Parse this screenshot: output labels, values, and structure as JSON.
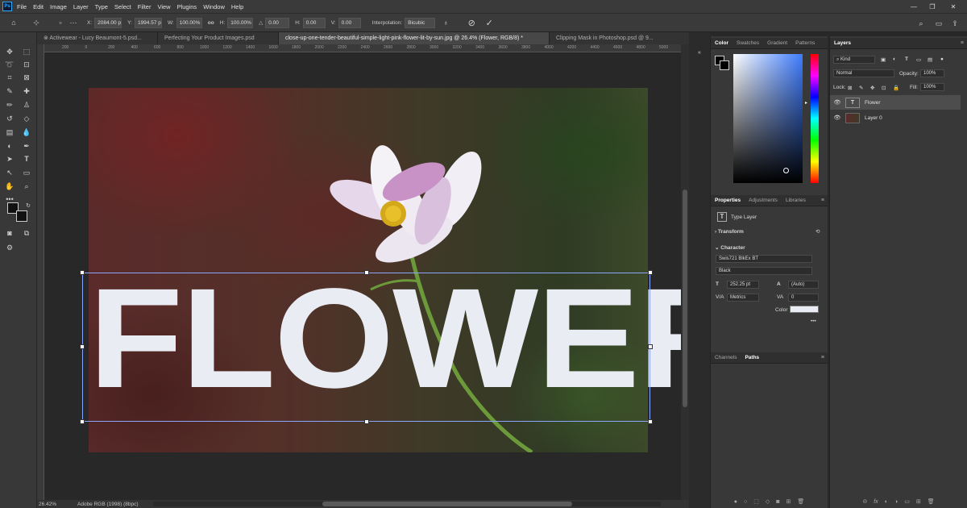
{
  "app": {
    "logo": "Ps"
  },
  "menu": [
    "File",
    "Edit",
    "Image",
    "Layer",
    "Type",
    "Select",
    "Filter",
    "View",
    "Plugins",
    "Window",
    "Help"
  ],
  "window_controls": {
    "minimize": "—",
    "restore": "❐",
    "close": "✕"
  },
  "options": {
    "x_label": "X:",
    "x_value": "2084.00 p",
    "y_label": "Y:",
    "y_value": "1994.57 p",
    "w_label": "W:",
    "w_value": "100.00%",
    "link": "oo",
    "h_label": "H:",
    "h_value": "100.00%",
    "angle_label": "△",
    "angle_value": "0.00",
    "hskew_label": "H:",
    "hskew_value": "0.00",
    "vskew_label": "V:",
    "vskew_value": "0.00",
    "interp_label": "Interpolation:",
    "interp_value": "Bicubic",
    "cancel": "⊘",
    "commit": "✓"
  },
  "tabs": [
    {
      "label": "⊗ Activewear - Lucy Beaumont-5.psd..."
    },
    {
      "label": "Perfecting Your Product Images.psd"
    },
    {
      "label": "close-up-one-tender-beautiful-simple-light-pink-flower-lit-by-sun.jpg @ 26.4% (Flower, RGB/8) *"
    },
    {
      "label": "Clipping Mask in Photoshop.psd @ 9..."
    }
  ],
  "ruler_ticks": [
    "200",
    "0",
    "200",
    "400",
    "600",
    "800",
    "1000",
    "1200",
    "1400",
    "1600",
    "1800",
    "2000",
    "2200",
    "2400",
    "2600",
    "2800",
    "3000",
    "3200",
    "3400",
    "3600",
    "3800",
    "4000",
    "4200",
    "4400",
    "4600",
    "4800",
    "5000",
    "5200"
  ],
  "canvas": {
    "text": "FLOWER"
  },
  "status": {
    "zoom": "26.42%",
    "profile": "Adobe RGB (1998) (8bpc)"
  },
  "color_panel": {
    "tabs": [
      "Color",
      "Swatches",
      "Gradient",
      "Patterns"
    ]
  },
  "properties": {
    "tabs": [
      "Properties",
      "Adjustments",
      "Libraries"
    ],
    "type_layer": "Type Layer",
    "transform": "Transform",
    "character": "Character",
    "font_family": "Swis721 BlkEx BT",
    "font_style": "Black",
    "font_size": "252.25 pt",
    "leading": "(Auto)",
    "kerning": "Metrics",
    "tracking": "0",
    "color_label": "Color",
    "more": "•••",
    "text_color": "#e9ecf3"
  },
  "paths_panel": {
    "tabs": [
      "Channels",
      "Paths"
    ]
  },
  "layers": {
    "title": "Layers",
    "kind": "Kind",
    "blend": "Normal",
    "opacity_label": "Opacity:",
    "opacity": "100%",
    "lock_label": "Lock:",
    "fill_label": "Fill:",
    "fill": "100%",
    "items": [
      {
        "name": "Flower",
        "thumb": "T"
      },
      {
        "name": "Layer 0",
        "thumb": ""
      }
    ],
    "footer": [
      "⊝",
      "fx",
      "◐",
      "◑",
      "▭",
      "⊞",
      "🗑"
    ]
  }
}
